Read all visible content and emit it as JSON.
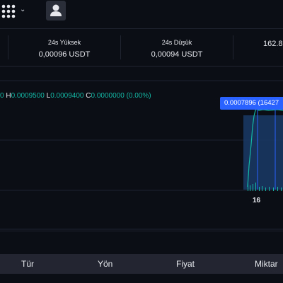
{
  "icons": {
    "apps": "apps-grid-icon",
    "chevron": "chevron-down-icon",
    "user": "user-icon"
  },
  "stats": [
    {
      "label": "",
      "value": ""
    },
    {
      "label": "24s Yüksek",
      "value": "0,00096 USDT"
    },
    {
      "label": "24s Düşük",
      "value": "0,00094 USDT"
    },
    {
      "label": "",
      "value": "162.8"
    }
  ],
  "ohlc": {
    "h_key": "H",
    "h": "0.0009500",
    "l_key": "L",
    "l": "0.0009400",
    "c_key": "C",
    "c": "0.0000000",
    "change": "(0.00%)",
    "lead": "0"
  },
  "chart": {
    "price_tag": "0.0007896 (16427",
    "x_tick": "16",
    "colors": {
      "up": "#13b8a6",
      "price_line": "#2962ff",
      "area": "#1a3a66"
    }
  },
  "table": {
    "headers": [
      "Tür",
      "Yön",
      "Fiyat",
      "Miktar"
    ]
  }
}
